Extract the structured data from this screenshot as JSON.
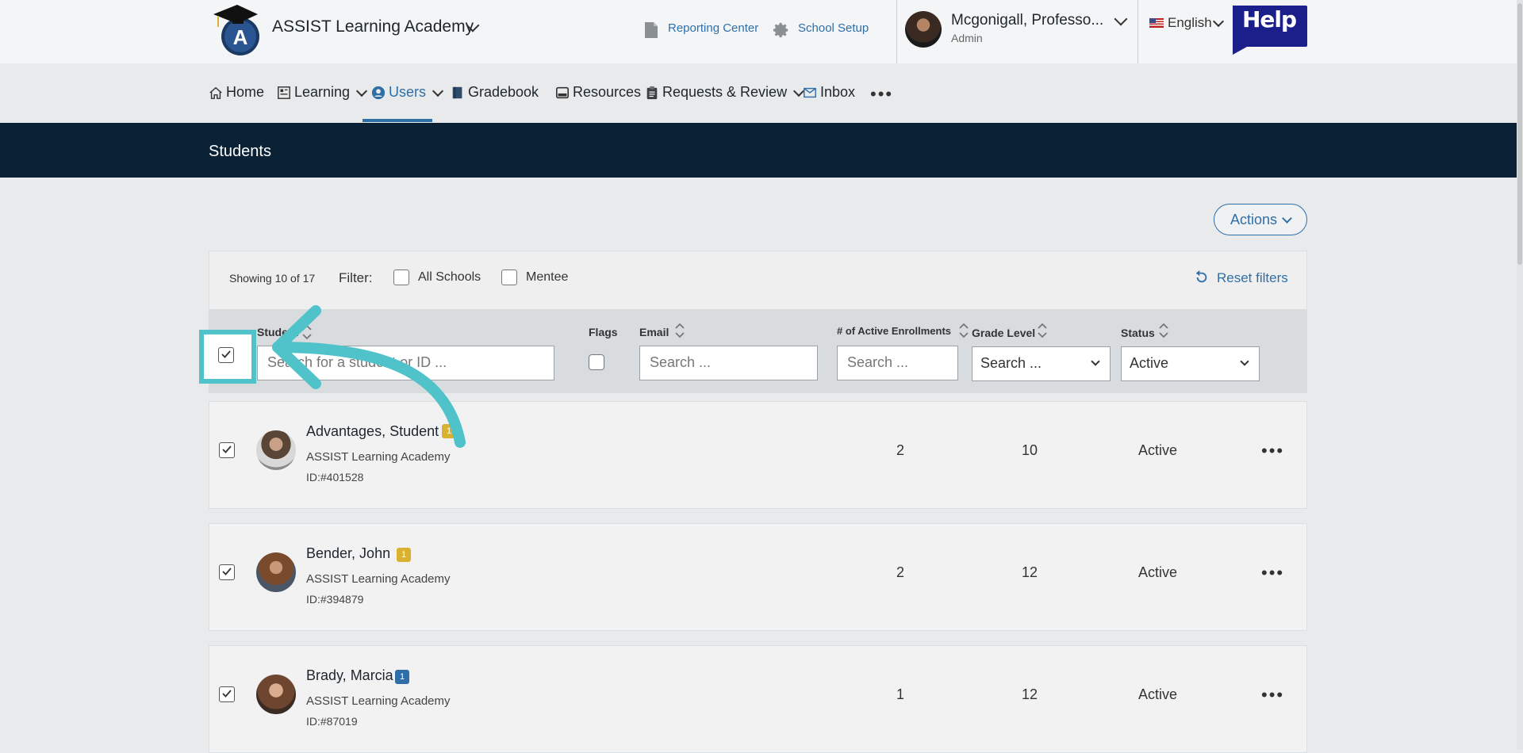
{
  "header": {
    "school_name": "ASSIST Learning Academy",
    "reporting_center": "Reporting Center",
    "school_setup": "School Setup",
    "user_name": "Mcgonigall, Professo...",
    "user_role": "Admin",
    "language": "English",
    "help": "Help"
  },
  "nav": {
    "home": "Home",
    "learning": "Learning",
    "users": "Users",
    "gradebook": "Gradebook",
    "resources": "Resources",
    "requests": "Requests & Review",
    "inbox": "Inbox",
    "more": "•••"
  },
  "page": {
    "title": "Students",
    "actions": "Actions"
  },
  "filters": {
    "showing": "Showing 10 of 17",
    "filter_label": "Filter:",
    "all_schools": "All Schools",
    "mentee": "Mentee",
    "reset": "Reset filters"
  },
  "columns": {
    "student": "Student",
    "flags": "Flags",
    "email": "Email",
    "enrollments": "# of Active Enrollments",
    "grade": "Grade Level",
    "status": "Status",
    "student_placeholder": "Search for a student or ID ...",
    "email_placeholder": "Search ...",
    "enroll_placeholder": "Search ...",
    "grade_value": "Search ...",
    "status_value": "Active"
  },
  "rows": [
    {
      "name": "Advantages, Student",
      "school": "ASSIST Learning Academy",
      "id": "ID:#401528",
      "badge": "1",
      "badge_color": "#d8b230",
      "enrollments": "2",
      "grade": "10",
      "status": "Active",
      "more": "•••"
    },
    {
      "name": "Bender, John",
      "school": "ASSIST Learning Academy",
      "id": "ID:#394879",
      "badge": "1",
      "badge_color": "#d8b230",
      "enrollments": "2",
      "grade": "12",
      "status": "Active",
      "more": "•••"
    },
    {
      "name": "Brady, Marcia",
      "school": "ASSIST Learning Academy",
      "id": "ID:#87019",
      "badge": "1",
      "badge_color": "#2f6fa8",
      "enrollments": "1",
      "grade": "12",
      "status": "Active",
      "more": "•••"
    }
  ],
  "colors": {
    "accent": "#2f6fa8",
    "title_bar": "#0b2136",
    "highlight": "#4fc3c9"
  }
}
